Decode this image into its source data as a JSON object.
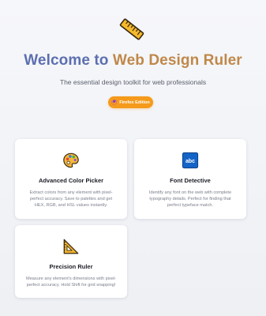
{
  "header": {
    "title_part1": "Welcome to",
    "title_part2": "Web Design Ruler",
    "subtitle": "The essential design toolkit for web professionals",
    "edition_badge": "Firefox Edition"
  },
  "features": [
    {
      "title": "Advanced Color Picker",
      "description": "Extract colors from any element with pixel-perfect accuracy. Save to palettes and get HEX, RGB, and HSL values instantly.",
      "icon": "palette-icon"
    },
    {
      "title": "Font Detective",
      "description": "Identify any font on the web with complete typography details. Perfect for finding that perfect typeface match.",
      "icon": "abc-icon",
      "icon_text": "abc"
    },
    {
      "title": "Precision Ruler",
      "description": "Measure any element's dimensions with pixel-perfect accuracy. Hold Shift for grid snapping!",
      "icon": "triangle-ruler-icon"
    }
  ],
  "colors": {
    "title_blue": "#5c6fb0",
    "title_gold": "#c0884a",
    "badge_orange": "#f59a1b",
    "abc_blue": "#1464c8"
  }
}
